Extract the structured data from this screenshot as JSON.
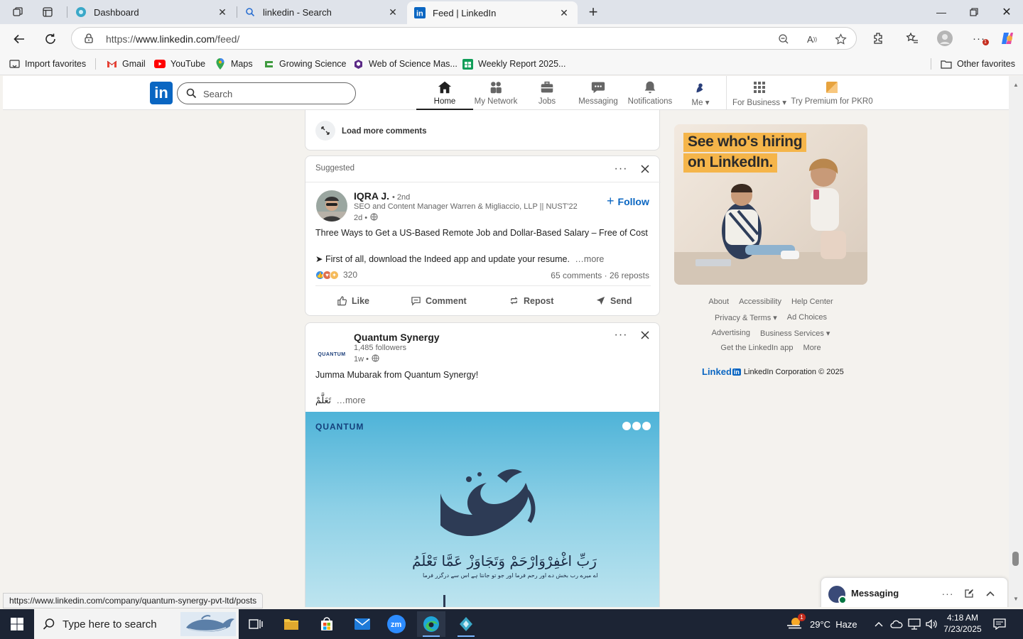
{
  "browser": {
    "tabs": [
      {
        "title": "Dashboard",
        "active": false
      },
      {
        "title": "linkedin - Search",
        "active": false
      },
      {
        "title": "Feed | LinkedIn",
        "active": true
      }
    ],
    "url_prefix": "https://",
    "url_main": "www.linkedin.com",
    "url_path": "/feed/",
    "favorites": [
      {
        "label": "Import favorites",
        "icon": "import-icon"
      },
      {
        "label": "Gmail",
        "icon": "gmail-icon"
      },
      {
        "label": "YouTube",
        "icon": "youtube-icon"
      },
      {
        "label": "Maps",
        "icon": "maps-pin-icon"
      },
      {
        "label": "Growing Science",
        "icon": "growing-science-icon"
      },
      {
        "label": "Web of Science Mas...",
        "icon": "web-of-science-icon"
      },
      {
        "label": "Weekly Report 2025...",
        "icon": "sheets-icon"
      }
    ],
    "other_favorites": "Other favorites",
    "status_url": "https://www.linkedin.com/company/quantum-synergy-pvt-ltd/posts"
  },
  "linkedin": {
    "search_placeholder": "Search",
    "nav": [
      {
        "label": "Home",
        "icon": "home-icon",
        "active": true
      },
      {
        "label": "My Network",
        "icon": "network-icon",
        "active": false
      },
      {
        "label": "Jobs",
        "icon": "briefcase-icon",
        "active": false
      },
      {
        "label": "Messaging",
        "icon": "messaging-icon",
        "active": false
      },
      {
        "label": "Notifications",
        "icon": "bell-icon",
        "active": false
      },
      {
        "label": "Me",
        "icon": "avatar-icon",
        "active": false
      },
      {
        "label": "For Business",
        "icon": "grid-icon",
        "active": false
      },
      {
        "label": "Try Premium for PKR0",
        "icon": "premium-icon",
        "active": false
      }
    ],
    "load_more": "Load more comments",
    "post1": {
      "label": "Suggested",
      "author": "IQRA J.",
      "degree": "• 2nd",
      "headline": "SEO and Content Manager Warren & Migliaccio, LLP || NUST'22",
      "time": "2d •",
      "follow": "Follow",
      "text1": "Three Ways to Get a US-Based Remote Job and Dollar-Based Salary – Free of Cost",
      "text2": "➤ First of all, download the Indeed app and update your resume.",
      "more": "…more",
      "reactions": "320",
      "stats": "65 comments · 26 reposts",
      "actions": [
        "Like",
        "Comment",
        "Repost",
        "Send"
      ]
    },
    "post2": {
      "author": "Quantum Synergy",
      "followers": "1,485 followers",
      "time": "1w •",
      "logo_text": "QUANTUM",
      "text1": "Jumma Mubarak from Quantum Synergy!",
      "text2": "تَعَلَّمْ",
      "more": "…more",
      "image_logo": "QUANTUM",
      "image_arabic": "رَبِّ اغْفِرْوَارْحَمْ وَتَجَاوَزْ عَمَّا تَعْلَمُ",
      "image_arabic_small": "اے میرے رب بخش دے اور رحم فرما اور جو تو جانتا ہے اس سے درگزر فرما"
    },
    "ad": {
      "line1": "See who's hiring",
      "line2": "on LinkedIn."
    },
    "footer_rows": [
      [
        "About",
        "Accessibility",
        "Help Center"
      ],
      [
        "Privacy & Terms ▾",
        "Ad Choices"
      ],
      [
        "Advertising",
        "Business Services ▾"
      ],
      [
        "Get the LinkedIn app",
        "More"
      ]
    ],
    "copyright_brand": "Linked",
    "copyright_in": "in",
    "copyright": "LinkedIn Corporation © 2025",
    "messaging": "Messaging"
  },
  "taskbar": {
    "search_placeholder": "Type here to search",
    "weather": "29°C  Haze",
    "weather_badge": "1",
    "time": "4:18 AM",
    "date": "7/23/2025"
  },
  "colors": {
    "linkedin_blue": "#0a66c2",
    "page_bg": "#f4f2ee",
    "ad_highlight": "#f5b54a",
    "taskbar": "#1c2434"
  }
}
